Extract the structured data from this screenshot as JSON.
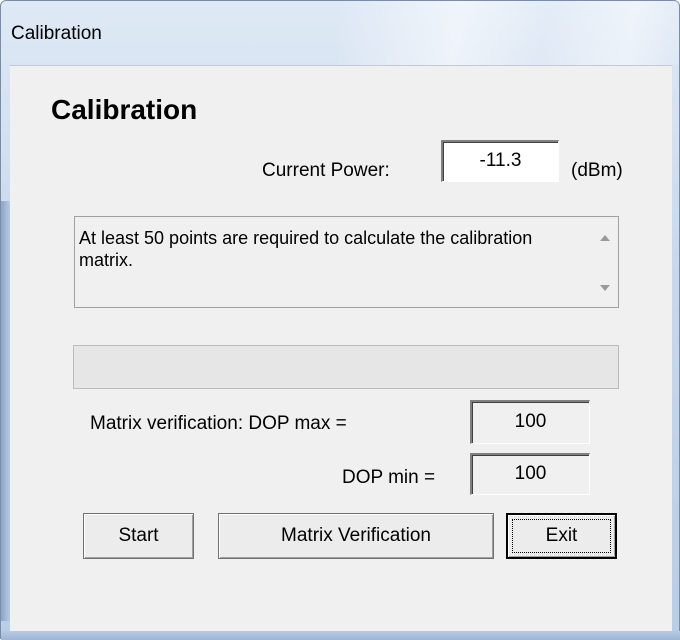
{
  "window": {
    "title": "Calibration"
  },
  "heading": "Calibration",
  "current_power": {
    "label": "Current Power:",
    "value": "-11.3",
    "unit": "(dBm)"
  },
  "message": "At least 50 points are required to calculate the calibration matrix.",
  "progress": {
    "value": 0
  },
  "verification": {
    "dop_max_label": "Matrix verification: DOP max =",
    "dop_max_value": "100",
    "dop_min_label": "DOP min =",
    "dop_min_value": "100"
  },
  "buttons": {
    "start": "Start",
    "matrix_verification": "Matrix Verification",
    "exit": "Exit"
  }
}
